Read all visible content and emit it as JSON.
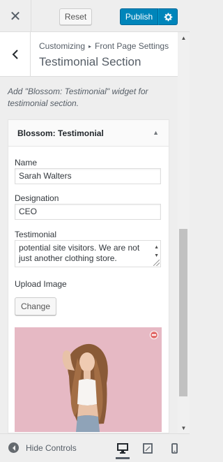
{
  "header": {
    "close_icon": "close-icon",
    "reset_label": "Reset",
    "publish_label": "Publish",
    "publish_settings_icon": "gear-icon"
  },
  "section": {
    "back_icon": "chevron-left-icon",
    "breadcrumb_root": "Customizing",
    "breadcrumb_parent": "Front Page Settings",
    "title": "Testimonial Section"
  },
  "description": "Add \"Blossom: Testimonial\" widget for testimonial section.",
  "widget": {
    "title": "Blossom: Testimonial",
    "toggle_icon": "caret-up-icon",
    "name_label": "Name",
    "name_value": "Sarah Walters",
    "designation_label": "Designation",
    "designation_value": "CEO",
    "testimonial_label": "Testimonial",
    "testimonial_text": "potential site visitors. We are not just another clothing store.",
    "upload_label": "Upload Image",
    "change_label": "Change",
    "remove_icon": "remove-circle-icon"
  },
  "footer": {
    "hide_controls_label": "Hide Controls",
    "devices": [
      "desktop",
      "tablet",
      "mobile"
    ],
    "active_device": "desktop"
  },
  "colors": {
    "primary": "#0085ba",
    "background": "#eeeeee",
    "remove": "#e26f6f"
  }
}
